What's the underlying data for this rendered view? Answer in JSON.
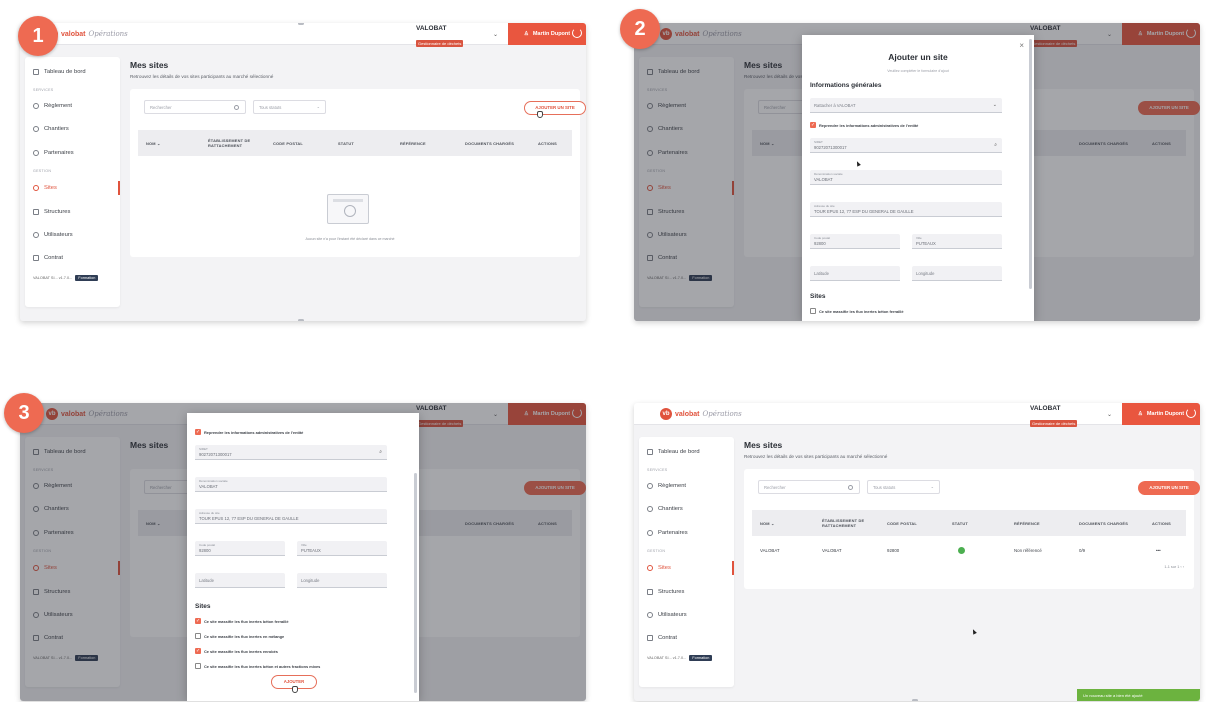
{
  "steps": [
    "1",
    "2",
    "3"
  ],
  "app": {
    "logo_mark": "vb",
    "logo_text": "valobat",
    "logo_script": "Opérations",
    "client_name": "VALOBAT",
    "client_role": "Gestionnaire de déchets",
    "user_name": "Martin Dupont"
  },
  "sidebar": {
    "dashboard": "Tableau de bord",
    "section_services": "SERVICES",
    "reglement": "Règlement",
    "chantiers": "Chantiers",
    "partenaires": "Partenaires",
    "section_gestion": "GESTION",
    "sites": "Sites",
    "structures": "Structures",
    "utilisateurs": "Utilisateurs",
    "contrat": "Contrat",
    "footer_text": "VALOBAT SI... v1.7.0...",
    "footer_badge": "Formation"
  },
  "page": {
    "title": "Mes sites",
    "subtitle": "Retrouvez les détails de vos sites participants au marché sélectionné",
    "search_placeholder": "Rechercher",
    "filter_placeholder": "Tous statuts",
    "add_button": "AJOUTER UN SITE",
    "empty_text": "Aucun site n'a pour l'instant été déclaré dans ce marché"
  },
  "table": {
    "columns": [
      "NOM ⌄",
      "ÉTABLISSEMENT DE RATTACHEMENT",
      "CODE POSTAL",
      "STATUT",
      "RÉFÉRENCE",
      "DOCUMENTS CHARGÉS",
      "ACTIONS"
    ],
    "row": {
      "nom": "VALOBAT",
      "etablissement": "VALOBAT",
      "code_postal": "92800",
      "statut": "ok",
      "reference": "Non référencé",
      "documents": "0/9",
      "actions": "•••"
    },
    "pager": "1-1 sur 1   ‹   ›"
  },
  "modal": {
    "title": "Ajouter un site",
    "subtitle": "Veuillez compléter le formulaire d'ajout",
    "section_general": "Informations générales",
    "rattachement_placeholder": "Rattacher à VALOBAT",
    "reprendre_check": "Reprendre les informations administratives de l'entité",
    "siret_label": "SIRET",
    "siret_value": "90272071300017",
    "denomination_label": "Dénomination sociale",
    "denomination_value": "VALOBAT",
    "adresse_label": "Adresse du site",
    "adresse_value": "TOUR EPUS 12, 77 ESP DU GENERAL DE GAULLE",
    "cp_label": "Code postal",
    "cp_value": "92800",
    "ville_label": "Ville",
    "ville_value": "PUTEAUX",
    "latitude_placeholder": "Latitude",
    "longitude_placeholder": "Longitude",
    "section_sites": "Sites",
    "options": [
      "Ce site massifie les flux inertes béton ferraillé",
      "Ce site massifie les flux inertes en mélange",
      "Ce site massifie les flux inertes enrobés",
      "Ce site massifie les flux inertes béton et autres fractions mixes"
    ],
    "submit": "AJOUTER"
  },
  "toast": "Un nouveau site a bien été ajouté",
  "colors": {
    "accent": "#e0533d",
    "success": "#4caf50"
  }
}
